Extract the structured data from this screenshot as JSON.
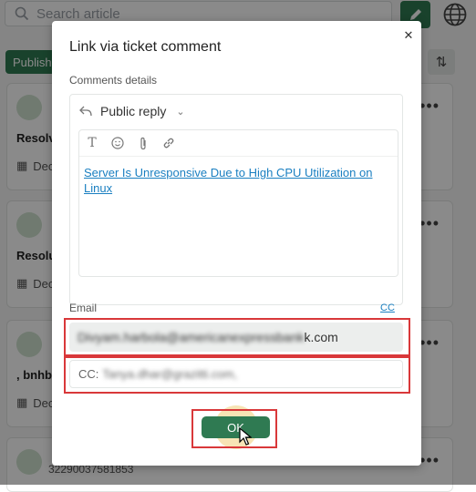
{
  "background": {
    "search_placeholder": "Search article",
    "publish_label": "Publish",
    "cards": [
      {
        "title": "Resolv",
        "date": "Dec"
      },
      {
        "title": "Resolu",
        "date": "Dec"
      },
      {
        "title": ", bnhb l",
        "date": "Dec"
      },
      {
        "id": "32290037581853"
      }
    ]
  },
  "modal": {
    "title": "Link via ticket comment",
    "comments_label": "Comments details",
    "reply_type": "Public reply",
    "editor_link_text": "Server Is Unresponsive Due to High CPU Utilization on Linux",
    "email_label": "Email",
    "cc_link": "CC",
    "email_value_blurred": "Divyam.harbola@americanexpressbank",
    "email_value_visible": "k.com",
    "cc_prefix": "CC:",
    "cc_value": "Tanya.dhar@grazitti.com,",
    "ok_label": "OK"
  },
  "colors": {
    "primary_green": "#2f7a52",
    "link_blue": "#1a7fc1",
    "highlight_red": "#d9383a"
  }
}
